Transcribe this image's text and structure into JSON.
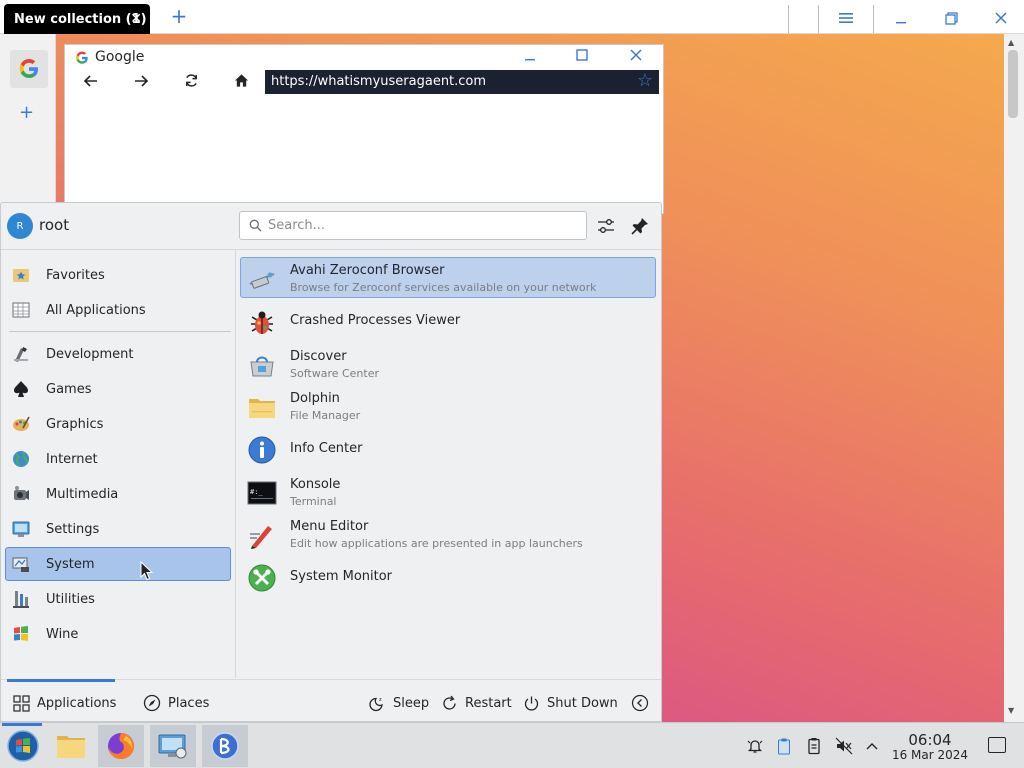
{
  "topbar": {
    "active_tab_label": "New collection (1)",
    "active_tab_close": "✕",
    "new_tab": "+"
  },
  "sidebar": {
    "add": "+"
  },
  "browser": {
    "title": "Google",
    "url": "https://whatismyuseragaent.com"
  },
  "launcher": {
    "user": {
      "initial": "R",
      "name": "root"
    },
    "search": {
      "placeholder": "Search..."
    },
    "categories": [
      {
        "label": "Favorites",
        "icon": "star-folder-icon"
      },
      {
        "label": "All Applications",
        "icon": "grid-icon"
      },
      {
        "label": "Development",
        "icon": "development-icon"
      },
      {
        "label": "Games",
        "icon": "games-icon"
      },
      {
        "label": "Graphics",
        "icon": "graphics-icon"
      },
      {
        "label": "Internet",
        "icon": "globe-icon"
      },
      {
        "label": "Multimedia",
        "icon": "multimedia-icon"
      },
      {
        "label": "Settings",
        "icon": "settings-icon"
      },
      {
        "label": "System",
        "icon": "system-icon",
        "selected": true
      },
      {
        "label": "Utilities",
        "icon": "utilities-icon"
      },
      {
        "label": "Wine",
        "icon": "wine-icon"
      }
    ],
    "apps": [
      {
        "name": "Avahi Zeroconf Browser",
        "desc": "Browse for Zeroconf services available on your network",
        "selected": true
      },
      {
        "name": "Crashed Processes Viewer",
        "desc": ""
      },
      {
        "name": "Discover",
        "desc": "Software Center"
      },
      {
        "name": "Dolphin",
        "desc": "File Manager"
      },
      {
        "name": "Info Center",
        "desc": ""
      },
      {
        "name": "Konsole",
        "desc": "Terminal"
      },
      {
        "name": "Menu Editor",
        "desc": "Edit how applications are presented in app launchers"
      },
      {
        "name": "System Monitor",
        "desc": ""
      }
    ],
    "footer": {
      "applications": "Applications",
      "places": "Places",
      "sleep": "Sleep",
      "restart": "Restart",
      "shutdown": "Shut Down"
    }
  },
  "taskbar": {
    "clock_time": "06:04",
    "clock_date": "16 Mar 2024"
  },
  "colors": {
    "accent": "#3a78d8",
    "selection": "#a8c4ea",
    "panel": "#eff0f1"
  }
}
